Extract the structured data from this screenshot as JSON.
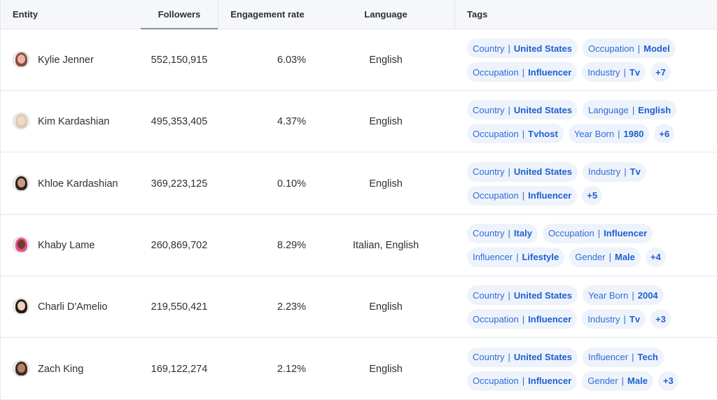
{
  "header": {
    "entity": "Entity",
    "followers": "Followers",
    "engagement": "Engagement rate",
    "language": "Language",
    "tags": "Tags"
  },
  "rows": [
    {
      "name": "Kylie Jenner",
      "followers": "552,150,915",
      "engagement": "6.03%",
      "language": "English",
      "tags_line1": [
        {
          "k": "Country",
          "v": "United States"
        },
        {
          "k": "Occupation",
          "v": "Model"
        }
      ],
      "tags_line2": [
        {
          "k": "Occupation",
          "v": "Influencer"
        },
        {
          "k": "Industry",
          "v": "Tv"
        }
      ],
      "more": "+7"
    },
    {
      "name": "Kim Kardashian",
      "followers": "495,353,405",
      "engagement": "4.37%",
      "language": "English",
      "tags_line1": [
        {
          "k": "Country",
          "v": "United States"
        },
        {
          "k": "Language",
          "v": "English"
        }
      ],
      "tags_line2": [
        {
          "k": "Occupation",
          "v": "Tvhost"
        },
        {
          "k": "Year Born",
          "v": "1980"
        }
      ],
      "more": "+6"
    },
    {
      "name": "Khloe Kardashian",
      "followers": "369,223,125",
      "engagement": "0.10%",
      "language": "English",
      "tags_line1": [
        {
          "k": "Country",
          "v": "United States"
        },
        {
          "k": "Industry",
          "v": "Tv"
        }
      ],
      "tags_line2": [
        {
          "k": "Occupation",
          "v": "Influencer"
        }
      ],
      "more": "+5"
    },
    {
      "name": "Khaby Lame",
      "followers": "260,869,702",
      "engagement": "8.29%",
      "language": "Italian, English",
      "tags_line1": [
        {
          "k": "Country",
          "v": "Italy"
        },
        {
          "k": "Occupation",
          "v": "Influencer"
        }
      ],
      "tags_line2": [
        {
          "k": "Influencer",
          "v": "Lifestyle"
        },
        {
          "k": "Gender",
          "v": "Male"
        }
      ],
      "more": "+4"
    },
    {
      "name": "Charli D'Amelio",
      "followers": "219,550,421",
      "engagement": "2.23%",
      "language": "English",
      "tags_line1": [
        {
          "k": "Country",
          "v": "United States"
        },
        {
          "k": "Year Born",
          "v": "2004"
        }
      ],
      "tags_line2": [
        {
          "k": "Occupation",
          "v": "Influencer"
        },
        {
          "k": "Industry",
          "v": "Tv"
        }
      ],
      "more": "+3"
    },
    {
      "name": "Zach King",
      "followers": "169,122,274",
      "engagement": "2.12%",
      "language": "English",
      "tags_line1": [
        {
          "k": "Country",
          "v": "United States"
        },
        {
          "k": "Influencer",
          "v": "Tech"
        }
      ],
      "tags_line2": [
        {
          "k": "Occupation",
          "v": "Influencer"
        },
        {
          "k": "Gender",
          "v": "Male"
        }
      ],
      "more": "+3"
    }
  ],
  "colors": {
    "tag_bg": "#eef3fb",
    "tag_text": "#1d5fd1",
    "header_bg": "#f6f7f9"
  }
}
